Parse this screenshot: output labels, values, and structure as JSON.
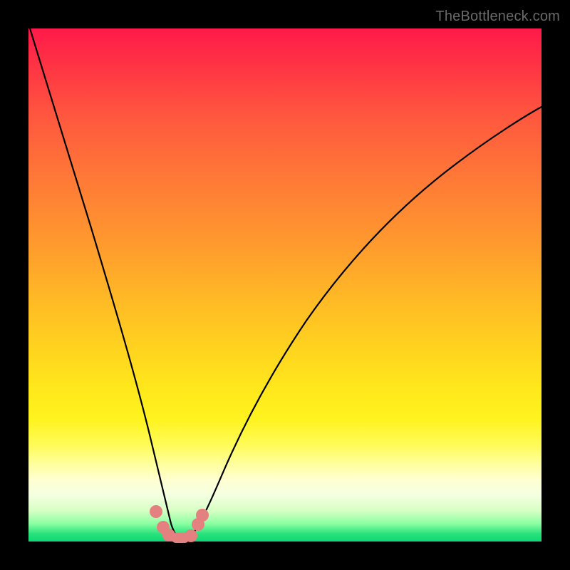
{
  "watermark": "TheBottleneck.com",
  "colors": {
    "frame": "#000000",
    "curve": "#000000",
    "marker": "#e48080",
    "gradient_stops": [
      "#ff1a49",
      "#ff2f45",
      "#ff5a3e",
      "#ff7b36",
      "#ff9a2e",
      "#ffb726",
      "#ffd21f",
      "#ffe71c",
      "#fff31e",
      "#fffb55",
      "#ffff9f",
      "#ffffd2",
      "#f4ffe0",
      "#d6ffc4",
      "#8cffa2",
      "#29e27c",
      "#0fd674"
    ]
  },
  "chart_data": {
    "type": "line",
    "title": "",
    "xlabel": "",
    "ylabel": "",
    "xlim": [
      0,
      100
    ],
    "ylim": [
      0,
      100
    ],
    "grid": false,
    "series": [
      {
        "name": "bottleneck-curve",
        "x": [
          0,
          4,
          8,
          12,
          16,
          20,
          23,
          25.5,
          27,
          29,
          31,
          33,
          36,
          40,
          46,
          54,
          64,
          76,
          90,
          100
        ],
        "y": [
          100,
          88,
          76,
          63,
          49,
          34,
          20,
          8,
          1,
          0,
          0.5,
          3,
          9,
          20,
          33,
          47,
          59,
          69,
          76,
          79
        ]
      }
    ],
    "markers": [
      {
        "x": 24.5,
        "y": 5.5
      },
      {
        "x": 26.0,
        "y": 2.2
      },
      {
        "x": 27.2,
        "y": 0.6
      },
      {
        "x": 29.0,
        "y": 0.0,
        "wide": true
      },
      {
        "x": 31.5,
        "y": 0.8
      },
      {
        "x": 33.0,
        "y": 3.2
      },
      {
        "x": 33.8,
        "y": 5.0
      }
    ],
    "annotations": []
  }
}
